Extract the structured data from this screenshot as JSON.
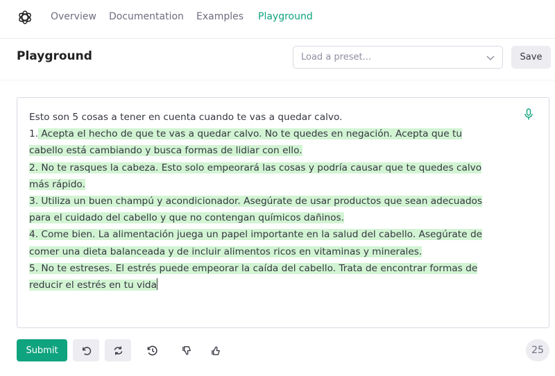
{
  "nav": {
    "links": [
      "Overview",
      "Documentation",
      "Examples",
      "Playground"
    ],
    "active": "Playground"
  },
  "header": {
    "title": "Playground",
    "preset_placeholder": "Load a preset...",
    "save_label": "Save"
  },
  "editor": {
    "prompt_lines": [
      "Esto son 5 cosas a tener en cuenta cuando te vas a quedar calvo."
    ],
    "completion_lines": [
      {
        "prefix": "1.",
        "text": " Acepta el hecho de que te vas a quedar calvo. No te quedes en negación. Acepta que tu"
      },
      {
        "prefix": "",
        "text": "cabello está cambiando y busca formas de lidiar con ello."
      },
      {
        "prefix": "",
        "text": "2. No te rasques la cabeza. Esto solo empeorará las cosas y podría causar que te quedes calvo"
      },
      {
        "prefix": "",
        "text": "más rápido."
      },
      {
        "prefix": "",
        "text": "3. Utiliza un buen champú y acondicionador. Asegúrate de usar productos que sean adecuados"
      },
      {
        "prefix": "",
        "text": " para el cuidado del cabello y que no contengan químicos dañinos."
      },
      {
        "prefix": "",
        "text": "4. Come bien. La alimentación juega un papel importante en la salud del cabello. Asegúrate de"
      },
      {
        "prefix": "",
        "text": "comer una dieta balanceada y de incluir alimentos ricos en vitaminas y minerales."
      },
      {
        "prefix": "",
        "text": "5. No te estreses. El estrés puede empeorar la caída del cabello. Trata de encontrar formas de"
      },
      {
        "prefix": "",
        "text": "reducir el estrés en tu vida"
      }
    ],
    "highlight_color": "#d2f4d3"
  },
  "footer": {
    "submit_label": "Submit",
    "token_count": "25"
  },
  "colors": {
    "accent": "#10a37f",
    "text": "#353740",
    "muted": "#6e6e80"
  },
  "icons": [
    "openai-logo-icon",
    "chevron-down-icon",
    "microphone-icon",
    "undo-icon",
    "regenerate-icon",
    "history-icon",
    "thumbs-down-icon",
    "thumbs-up-icon"
  ]
}
